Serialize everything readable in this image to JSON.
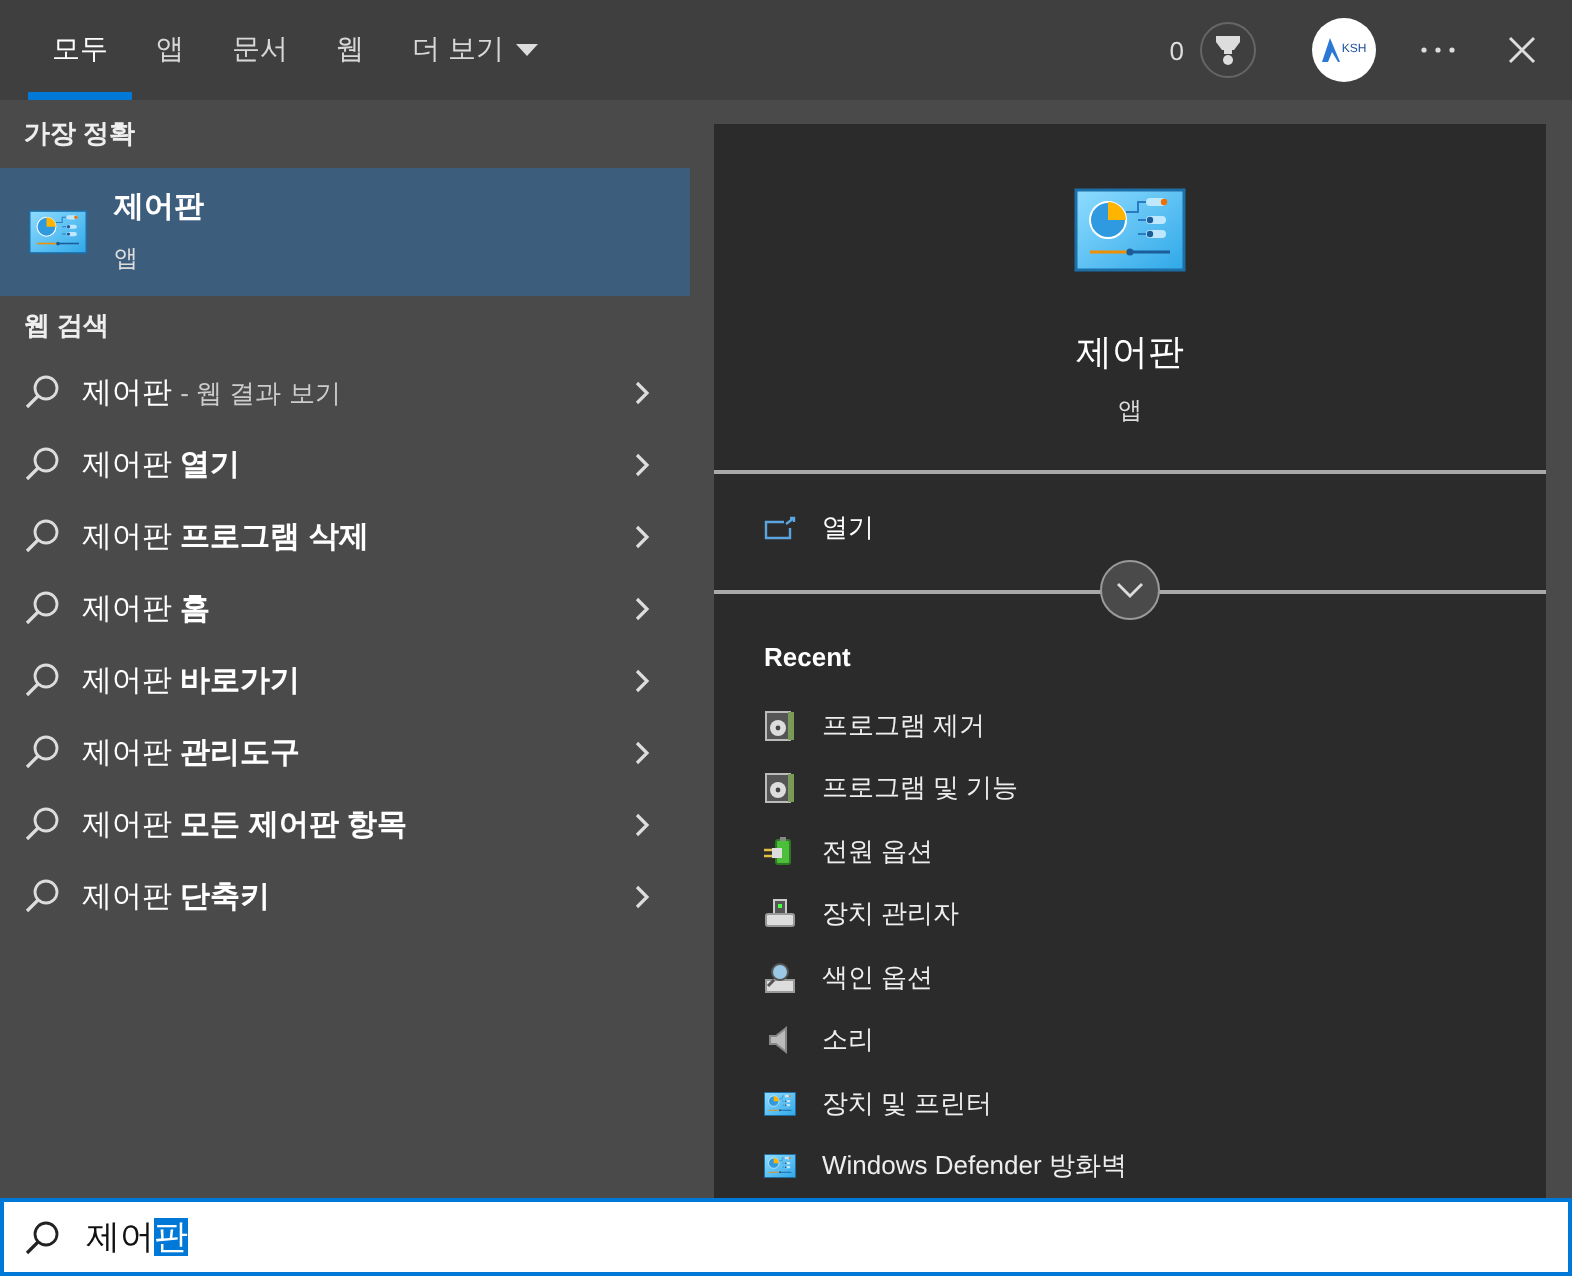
{
  "tabs": [
    {
      "label": "모두",
      "selected": true
    },
    {
      "label": "앱",
      "selected": false
    },
    {
      "label": "문서",
      "selected": false
    },
    {
      "label": "웹",
      "selected": false
    },
    {
      "label": "더 보기",
      "selected": false,
      "kind": "dropdown"
    }
  ],
  "toolbar": {
    "points": "0",
    "account_initials": "KSH"
  },
  "best_match": {
    "heading": "가장 정확",
    "title": "제어판",
    "subtitle": "앱",
    "selected": true
  },
  "web_search": {
    "heading": "웹 검색",
    "items": [
      {
        "query": "제어판",
        "hint": "- 웹 결과 보기"
      },
      {
        "query": "제어판",
        "rest": "열기"
      },
      {
        "query": "제어판",
        "rest": "프로그램 삭제"
      },
      {
        "query": "제어판",
        "rest": "홈"
      },
      {
        "query": "제어판",
        "rest": "바로가기"
      },
      {
        "query": "제어판",
        "rest": "관리도구"
      },
      {
        "query": "제어판",
        "rest": "모든 제어판 항목"
      },
      {
        "query": "제어판",
        "rest": "단축키"
      }
    ]
  },
  "preview": {
    "title": "제어판",
    "subtitle": "앱",
    "actions": [
      {
        "label": "열기"
      }
    ],
    "recent_heading": "Recent",
    "recent": [
      {
        "label": "프로그램 제거",
        "kind": "disc"
      },
      {
        "label": "프로그램 및 기능",
        "kind": "disc"
      },
      {
        "label": "전원 옵션",
        "kind": "power"
      },
      {
        "label": "장치 관리자",
        "kind": "device"
      },
      {
        "label": "색인 옵션",
        "kind": "index"
      },
      {
        "label": "소리",
        "kind": "sound"
      },
      {
        "label": "장치 및 프린터",
        "kind": "panel"
      },
      {
        "label": "Windows Defender 방화벽",
        "kind": "panel"
      }
    ]
  },
  "search": {
    "value": "제어",
    "composing": "판"
  }
}
